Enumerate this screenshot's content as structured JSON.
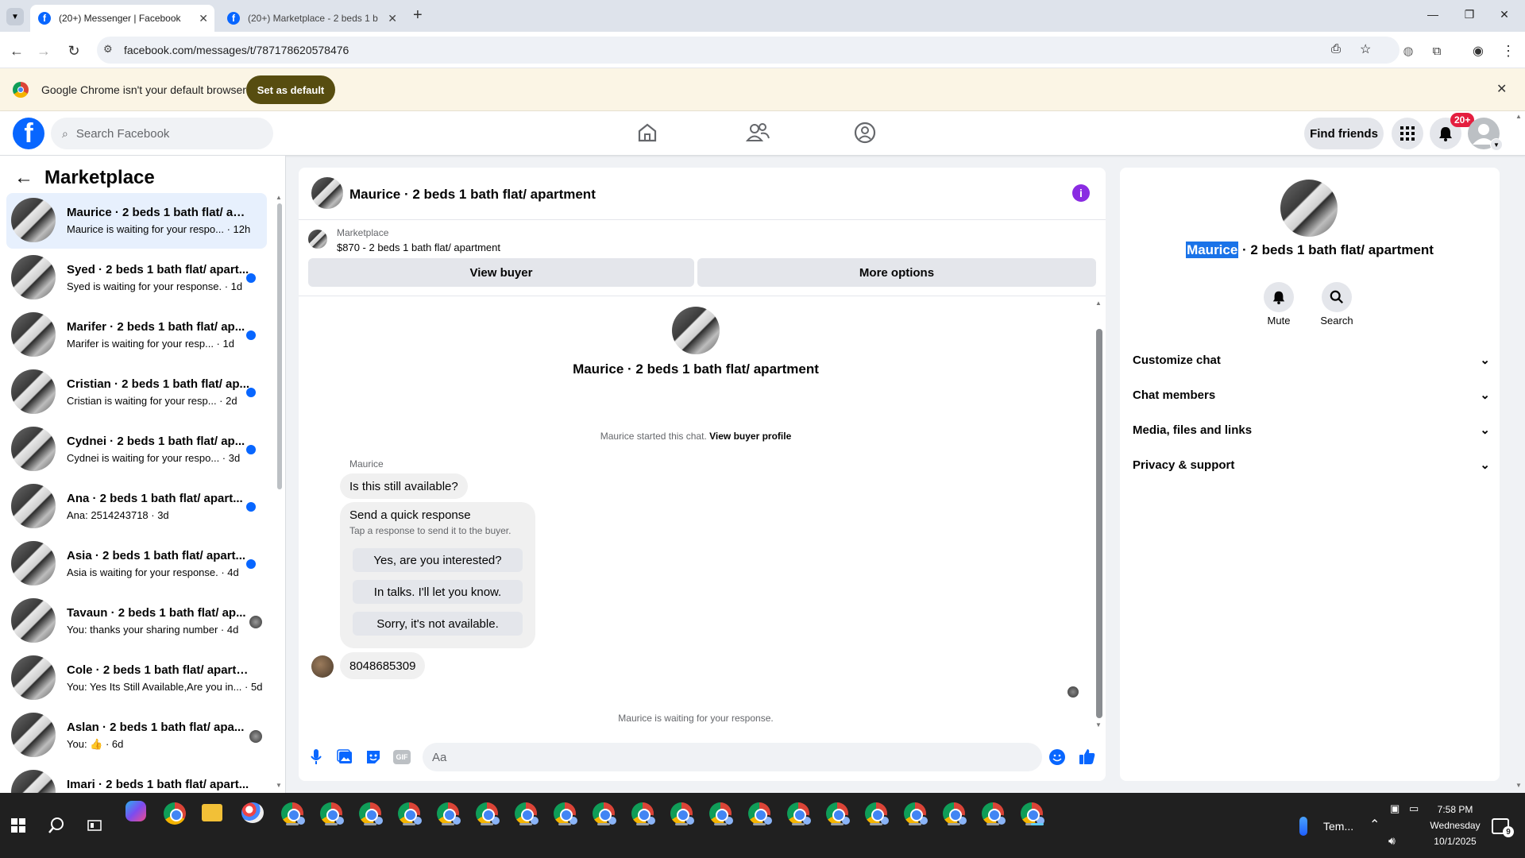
{
  "browser": {
    "tabs": [
      {
        "title": "(20+) Messenger | Facebook",
        "active": true
      },
      {
        "title": "(20+) Marketplace - 2 beds 1 b",
        "active": false
      }
    ],
    "url": "facebook.com/messages/t/787178620578476",
    "infobar_text": "Google Chrome isn't your default browser",
    "infobar_button": "Set as default"
  },
  "fb": {
    "search_placeholder": "Search Facebook",
    "find_friends": "Find friends",
    "notif_badge": "20+"
  },
  "left": {
    "title": "Marketplace",
    "conversations": [
      {
        "name": "Maurice · 2 beds 1 bath flat/ apa...",
        "preview": "Maurice is waiting for your respo... · 12h",
        "unread": false,
        "selected": true
      },
      {
        "name": "Syed · 2 beds 1 bath flat/ apart...",
        "preview": "Syed is waiting for your response. · 1d",
        "unread": true
      },
      {
        "name": "Marifer · 2 beds 1 bath flat/ ap...",
        "preview": "Marifer is waiting for your resp... · 1d",
        "unread": true
      },
      {
        "name": "Cristian · 2 beds 1 bath flat/ ap...",
        "preview": "Cristian is waiting for your resp... · 2d",
        "unread": true
      },
      {
        "name": "Cydnei · 2 beds 1 bath flat/ ap...",
        "preview": "Cydnei is waiting for your respo... · 3d",
        "unread": true
      },
      {
        "name": "Ana · 2 beds 1 bath flat/ apart...",
        "preview": "Ana: 2514243718 · 3d",
        "unread": true
      },
      {
        "name": "Asia · 2 beds 1 bath flat/ apart...",
        "preview": "Asia is waiting for your response. · 4d",
        "unread": true
      },
      {
        "name": "Tavaun · 2 beds 1 bath flat/ ap...",
        "preview": "You: thanks your sharing number · 4d",
        "unread": false
      },
      {
        "name": "Cole · 2 beds 1 bath flat/ apartm...",
        "preview": "You: Yes Its Still Available,Are you in... · 5d",
        "unread": false
      },
      {
        "name": "Aslan · 2 beds 1 bath flat/ apa...",
        "preview": "You: 👍 · 6d",
        "unread": false
      },
      {
        "name": "Imari · 2 beds 1 bath flat/ apart...",
        "preview": "",
        "unread": false
      }
    ]
  },
  "chat": {
    "title": "Maurice · 2 beds 1 bath flat/ apartment",
    "listing_source": "Marketplace",
    "listing_line": "$870 - 2 beds 1 bath flat/ apartment",
    "view_buyer": "View buyer",
    "more_options": "More options",
    "profile_name": "Maurice · 2 beds 1 bath flat/ apartment",
    "started_text": "Maurice started this chat.",
    "view_buyer_profile": "View buyer profile",
    "sender": "Maurice",
    "msg1": "Is this still available?",
    "quick_title": "Send a quick response",
    "quick_sub": "Tap a response to send it to the buyer.",
    "quick_responses": [
      "Yes, are you interested?",
      "In talks. I'll let you know.",
      "Sorry, it's not available."
    ],
    "msg2": "8048685309",
    "waiting": "Maurice is waiting for your response.",
    "composer_placeholder": "Aa"
  },
  "right": {
    "name_highlight": "Maurice",
    "name_rest": " · 2 beds 1 bath flat/ apartment",
    "mute": "Mute",
    "search": "Search",
    "sections": [
      "Customize chat",
      "Chat members",
      "Media, files and links",
      "Privacy & support"
    ]
  },
  "taskbar": {
    "weather": "Tem...",
    "time": "7:58 PM",
    "day": "Wednesday",
    "date": "10/1/2025",
    "notif_count": "9"
  }
}
